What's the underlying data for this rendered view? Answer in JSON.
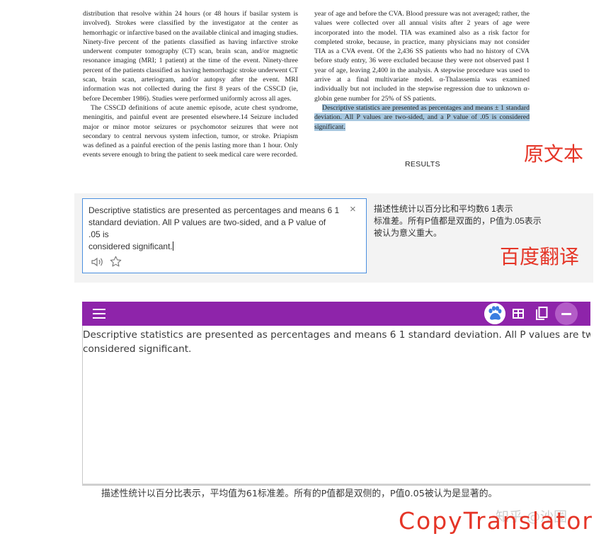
{
  "paper": {
    "left_column": [
      "distribution that resolve within 24 hours (or 48 hours if basilar system is involved). Strokes were classified by the investigator at the center as hemorrhagic or infarctive based on the available clinical and imaging studies. Ninety-five percent of the patients classified as having infarctive stroke underwent computer tomography (CT) scan, brain scan, and/or magnetic resonance imaging (MRI; 1 patient) at the time of the event. Ninety-three percent of the patients classified as having hemorrhagic stroke underwent CT scan, brain scan, arteriogram, and/or autopsy after the event. MRI information was not collected during the first 8 years of the CSSCD (ie, before December 1986). Studies were performed uniformly across all ages.",
      "The CSSCD definitions of acute anemic episode, acute chest syndrome, meningitis, and painful event are presented elsewhere.14 Seizure included major or minor motor seizures or psychomotor seizures that were not secondary to central nervous system infection, tumor, or stroke. Priapism was defined as a painful erection of the penis lasting more than 1 hour. Only events severe enough to bring the patient to seek medical care were recorded."
    ],
    "right_column": "year of age and before the CVA. Blood pressure was not averaged; rather, the values were collected over all annual visits after 2 years of age were incorporated into the model. TIA was examined also as a risk factor for completed stroke, because, in practice, many physicians may not consider TIA as a CVA event. Of the 2,436 SS patients who had no history of CVA before study entry, 36 were excluded because they were not observed past 1 year of age, leaving 2,400 in the analysis. A stepwise procedure was used to arrive at a final multivariate model. α-Thalassemia was examined individually but not included in the stepwise regression due to unknown α-globin gene number for 25% of SS patients.",
    "highlighted": "Descriptive statistics are presented as percentages and means ± 1 standard deviation. All P values are two-sided, and a P value of .05 is considered significant.",
    "results_heading": "RESULTS"
  },
  "labels": {
    "original": "原文本",
    "baidu": "百度翻译",
    "copytranslator": "CopyTranslator",
    "watermark": "知乎 @沙圈"
  },
  "baidu": {
    "source_lines": [
      "Descriptive statistics are presented as percentages and means 6 1",
      "standard deviation. All P values are two-sided, and a P value of",
      ".05 is",
      "considered significant."
    ],
    "close": "×",
    "output_lines": [
      "描述性统计以百分比和平均数6 1表示",
      "标准差。所有P值都是双面的，P值为.05表示",
      "被认为意义重大。"
    ]
  },
  "copytranslator": {
    "source_lines": [
      "Descriptive statistics are presented as percentages and means 6 1 standard deviation. All P values are two-sided,",
      "considered significant."
    ],
    "output": "描述性统计以百分比表示，平均值为61标准差。所有的P值都是双侧的，P值0.05被认为是显著的。"
  },
  "colors": {
    "toolbar": "#8e24aa",
    "label_red": "#e53527",
    "input_border": "#4a8fe0",
    "highlight": "#a8c8e0"
  },
  "icons": [
    "speaker-icon",
    "star-icon",
    "menu-icon",
    "paw-icon",
    "grid-icon",
    "copy-icon",
    "minus-icon"
  ]
}
